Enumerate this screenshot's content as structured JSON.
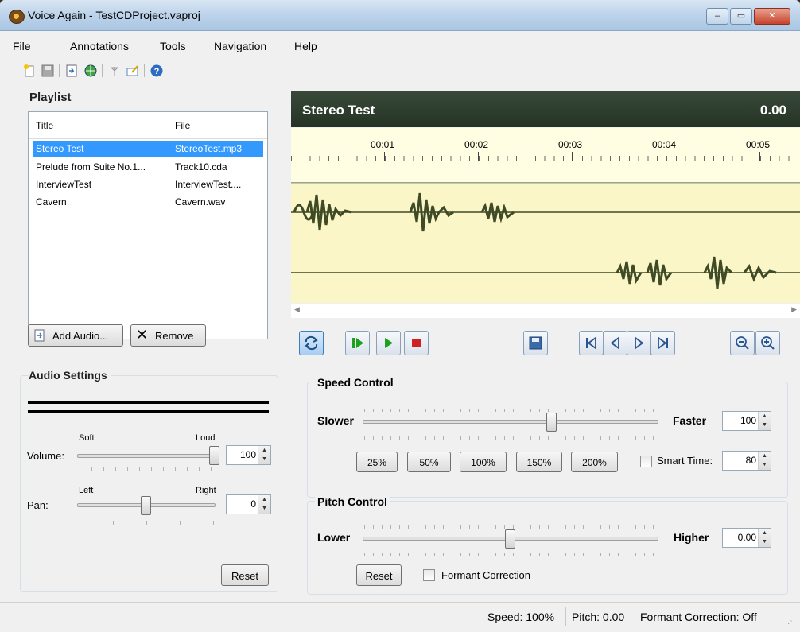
{
  "window": {
    "title": "Voice Again - TestCDProject.vaproj",
    "min": "‒",
    "max": "▭",
    "close": "✕"
  },
  "menu": [
    "File",
    "Annotations",
    "Tools",
    "Navigation",
    "Help"
  ],
  "toolbar_icons": [
    "new-file-icon",
    "save-icon",
    "export-icon",
    "web-icon",
    "marker-icon",
    "edit-icon",
    "help-icon"
  ],
  "playlist": {
    "label": "Playlist",
    "columns": [
      "Title",
      "File"
    ],
    "rows": [
      {
        "title": "Stereo Test",
        "file": "StereoTest.mp3",
        "selected": true
      },
      {
        "title": "Prelude from Suite No.1...",
        "file": "Track10.cda",
        "selected": false
      },
      {
        "title": "InterviewTest",
        "file": "InterviewTest....",
        "selected": false
      },
      {
        "title": "Cavern",
        "file": "Cavern.wav",
        "selected": false
      }
    ],
    "add_label": "Add Audio...",
    "remove_label": "Remove"
  },
  "audio_settings": {
    "label": "Audio Settings",
    "volume": {
      "label": "Volume:",
      "min_label": "Soft",
      "max_label": "Loud",
      "value": "100",
      "level": 1.0
    },
    "pan": {
      "label": "Pan:",
      "min_label": "Left",
      "max_label": "Right",
      "value": "0",
      "level": 0.5
    },
    "reset_label": "Reset"
  },
  "track": {
    "title": "Stereo Test",
    "time": "0.00",
    "ruler": [
      "00:01",
      "00:02",
      "00:03",
      "00:04",
      "00:05"
    ]
  },
  "transport_icons": [
    "loop-icon",
    "play-from-start-icon",
    "play-icon",
    "stop-icon",
    "save-clip-icon",
    "go-start-icon",
    "step-back-icon",
    "step-forward-icon",
    "go-end-icon",
    "zoom-out-icon",
    "zoom-in-icon"
  ],
  "speed": {
    "label": "Speed Control",
    "slower": "Slower",
    "faster": "Faster",
    "value": "100",
    "level": 0.64,
    "presets": [
      "25%",
      "50%",
      "100%",
      "150%",
      "200%"
    ],
    "smart_time_label": "Smart Time:",
    "smart_time_value": "80"
  },
  "pitch": {
    "label": "Pitch Control",
    "lower": "Lower",
    "higher": "Higher",
    "value": "0.00",
    "level": 0.5,
    "reset_label": "Reset",
    "formant_label": "Formant Correction"
  },
  "status": {
    "speed": "Speed: 100%",
    "pitch": "Pitch: 0.00",
    "formant": "Formant Correction: Off"
  },
  "colors": {
    "selection": "#3399ff",
    "track_header": "#2f3f2e",
    "waveform": "#3f4a26",
    "wave_bg": "#fbf6c7"
  }
}
